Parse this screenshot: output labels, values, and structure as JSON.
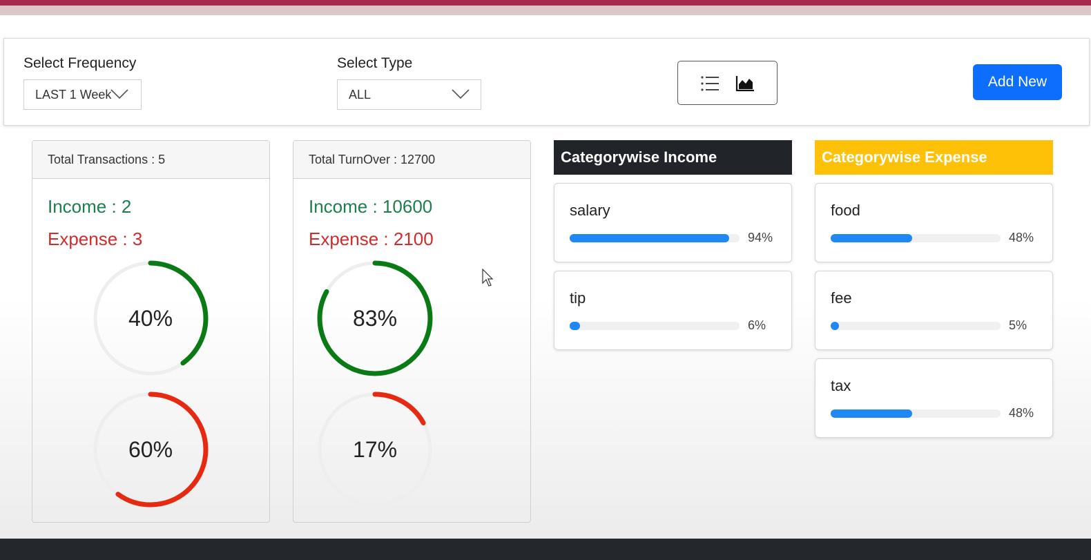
{
  "filters": {
    "frequency_label": "Select Frequency",
    "frequency_value": "LAST 1 Week",
    "type_label": "Select Type",
    "type_value": "ALL",
    "add_new_label": "Add New"
  },
  "colors": {
    "income": "#1e7d4f",
    "expense": "#d12c2c",
    "ring_income": "#0a7a14",
    "ring_expense": "#e62a12",
    "ring_track": "#eeeeee",
    "accent_blue": "#0d6efd",
    "bar_blue": "#1e88f5",
    "income_header_bg": "#212529",
    "expense_header_bg": "#ffc107"
  },
  "transactions_card": {
    "header": "Total Transactions : 5",
    "income": "Income : 2",
    "expense": "Expense : 3",
    "income_percent": 40,
    "expense_percent": 60,
    "income_percent_label": "40%",
    "expense_percent_label": "60%"
  },
  "turnover_card": {
    "header": "Total TurnOver : 12700",
    "income": "Income : 10600",
    "expense": "Expense : 2100",
    "income_percent": 83,
    "expense_percent": 17,
    "income_percent_label": "83%",
    "expense_percent_label": "17%"
  },
  "category_income": {
    "title": "Categorywise Income",
    "items": [
      {
        "name": "salary",
        "percent": 94,
        "percent_label": "94%"
      },
      {
        "name": "tip",
        "percent": 6,
        "percent_label": "6%"
      }
    ]
  },
  "category_expense": {
    "title": "Categorywise Expense",
    "items": [
      {
        "name": "food",
        "percent": 48,
        "percent_label": "48%"
      },
      {
        "name": "fee",
        "percent": 5,
        "percent_label": "5%"
      },
      {
        "name": "tax",
        "percent": 48,
        "percent_label": "48%"
      }
    ]
  },
  "icons": {
    "list_view": "list-icon",
    "chart_view": "area-chart-icon",
    "dropdown": "chevron-down-icon"
  }
}
